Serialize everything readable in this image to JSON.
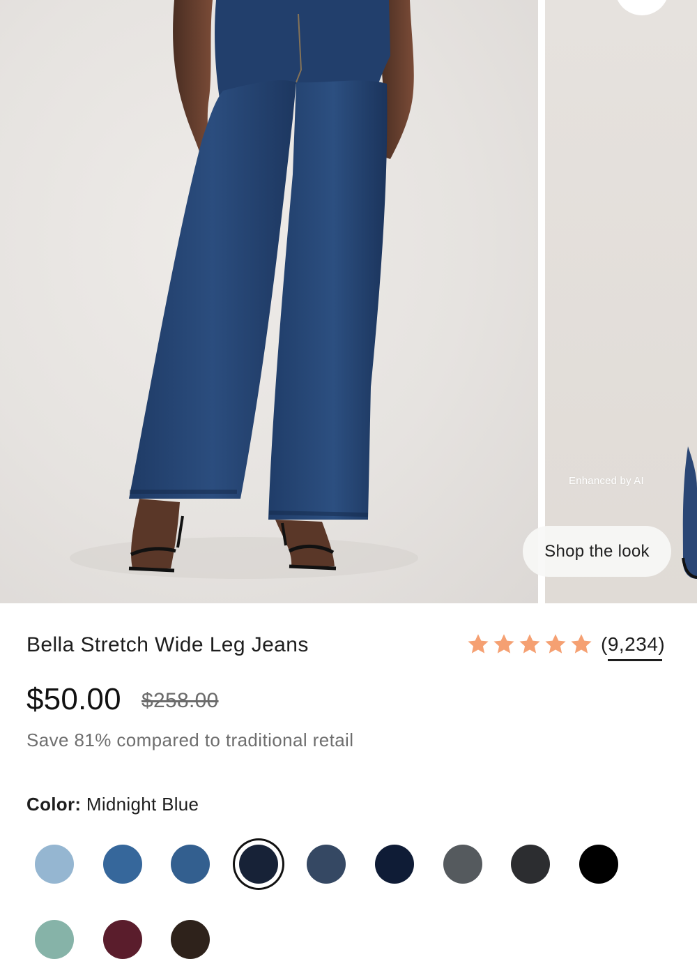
{
  "gallery": {
    "badge": "Enhanced by AI",
    "shop_the_look_label": "Shop the look"
  },
  "product": {
    "name": "Bella Stretch Wide Leg Jeans",
    "rating_stars": 5,
    "review_count": "(9,234)",
    "price": "$50.00",
    "original_price": "$258.00",
    "savings_note": "Save 81% compared to traditional retail"
  },
  "color": {
    "label": "Color:",
    "selected": "Midnight Blue",
    "swatches": [
      {
        "color": "#95b6d1"
      },
      {
        "color": "#36679b"
      },
      {
        "color": "#335f8f"
      },
      {
        "color": "#172237",
        "selected": true
      },
      {
        "color": "#354863"
      },
      {
        "color": "#0f1c36"
      },
      {
        "color": "#555a5e"
      },
      {
        "color": "#2c2d30"
      },
      {
        "color": "#000000"
      },
      {
        "color": "#86b3a8"
      },
      {
        "color": "#5a1d2c"
      },
      {
        "color": "#2e221b"
      }
    ]
  },
  "colors": {
    "star": "#f5a072",
    "text": "#1e1e1e",
    "muted": "#6e6e6e"
  }
}
